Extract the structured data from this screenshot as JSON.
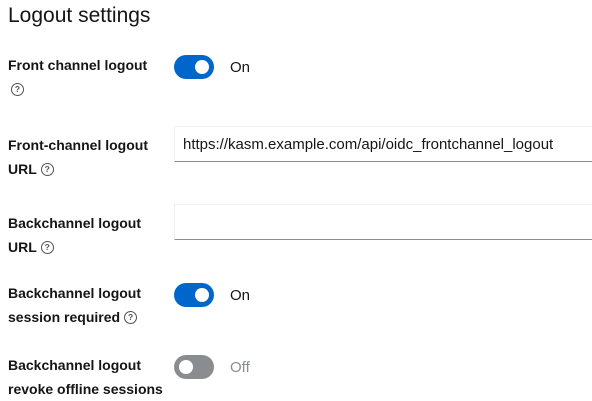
{
  "section": {
    "title": "Logout settings"
  },
  "fields": {
    "front_channel_logout": {
      "label": "Front channel logout",
      "state": "On"
    },
    "front_channel_logout_url": {
      "label_line1": "Front-channel logout",
      "label_line2": "URL",
      "value": "https://kasm.example.com/api/oidc_frontchannel_logout"
    },
    "backchannel_logout_url": {
      "label_line1": "Backchannel logout",
      "label_line2": "URL",
      "value": ""
    },
    "backchannel_logout_session_required": {
      "label_line1": "Backchannel logout",
      "label_line2": "session required",
      "state": "On"
    },
    "backchannel_logout_revoke_offline_sessions": {
      "label_line1": "Backchannel logout",
      "label_line2": "revoke offline sessions",
      "state": "Off"
    }
  },
  "help_icon": "?",
  "colors": {
    "toggle_on": "#0066cc",
    "toggle_off": "#8a8d90",
    "text": "#151515"
  }
}
